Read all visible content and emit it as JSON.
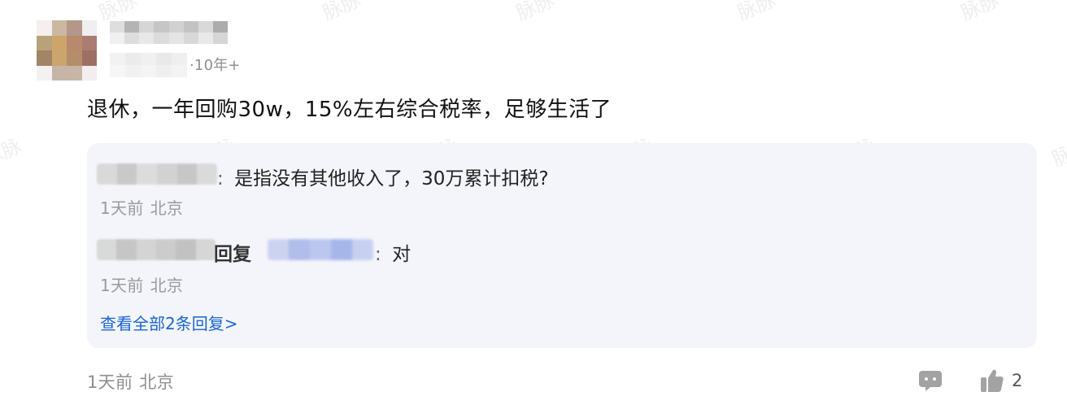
{
  "watermark_text": "脉脉",
  "post": {
    "author_tenure": "·10年+",
    "content": "退休，一年回购30w，15%左右综合税率，足够生活了",
    "time": "1天前",
    "location": "北京",
    "like_count": "2",
    "icons": {
      "comment": "comment-icon",
      "like": "thumbs-up-icon"
    }
  },
  "replies": [
    {
      "separator": ":",
      "text": "是指没有其他收入了，30万累计扣税?",
      "time": "1天前",
      "location": "北京"
    },
    {
      "reply_keyword": "回复",
      "separator": ":",
      "text": "对",
      "time": "1天前",
      "location": "北京"
    }
  ],
  "view_all_replies": "查看全部2条回复>",
  "colors": {
    "link": "#1a66d6",
    "reply_bg": "#f4f5fb",
    "meta_gray": "#8f8f8f"
  }
}
